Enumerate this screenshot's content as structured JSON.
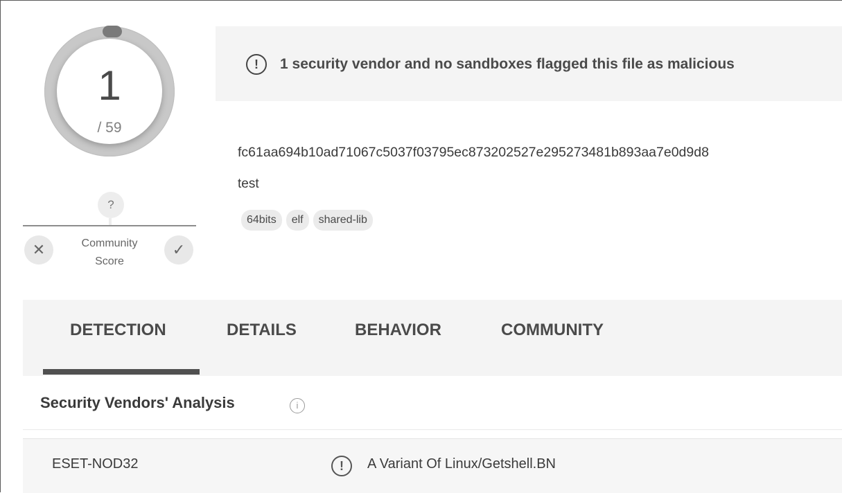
{
  "score": {
    "detections": "1",
    "total": "/ 59"
  },
  "community": {
    "score_value": "?",
    "label": "Community\nScore",
    "vote_down_symbol": "✕",
    "vote_up_symbol": "✓"
  },
  "alert": {
    "icon": "!",
    "text": "1 security vendor and no sandboxes flagged this file as malicious"
  },
  "file": {
    "hash": "fc61aa694b10ad71067c5037f03795ec873202527e295273481b893aa7e0d9d8",
    "name": "test",
    "tags": [
      "64bits",
      "elf",
      "shared-lib"
    ]
  },
  "tabs": [
    {
      "label": "DETECTION",
      "active": true
    },
    {
      "label": "DETAILS",
      "active": false
    },
    {
      "label": "BEHAVIOR",
      "active": false
    },
    {
      "label": "COMMUNITY",
      "active": false
    }
  ],
  "vendors_section": {
    "title": "Security Vendors' Analysis",
    "info_icon": "i"
  },
  "vendors": [
    {
      "name": "ESET-NOD32",
      "icon": "!",
      "result": "A Variant Of Linux/Getshell.BN"
    }
  ]
}
